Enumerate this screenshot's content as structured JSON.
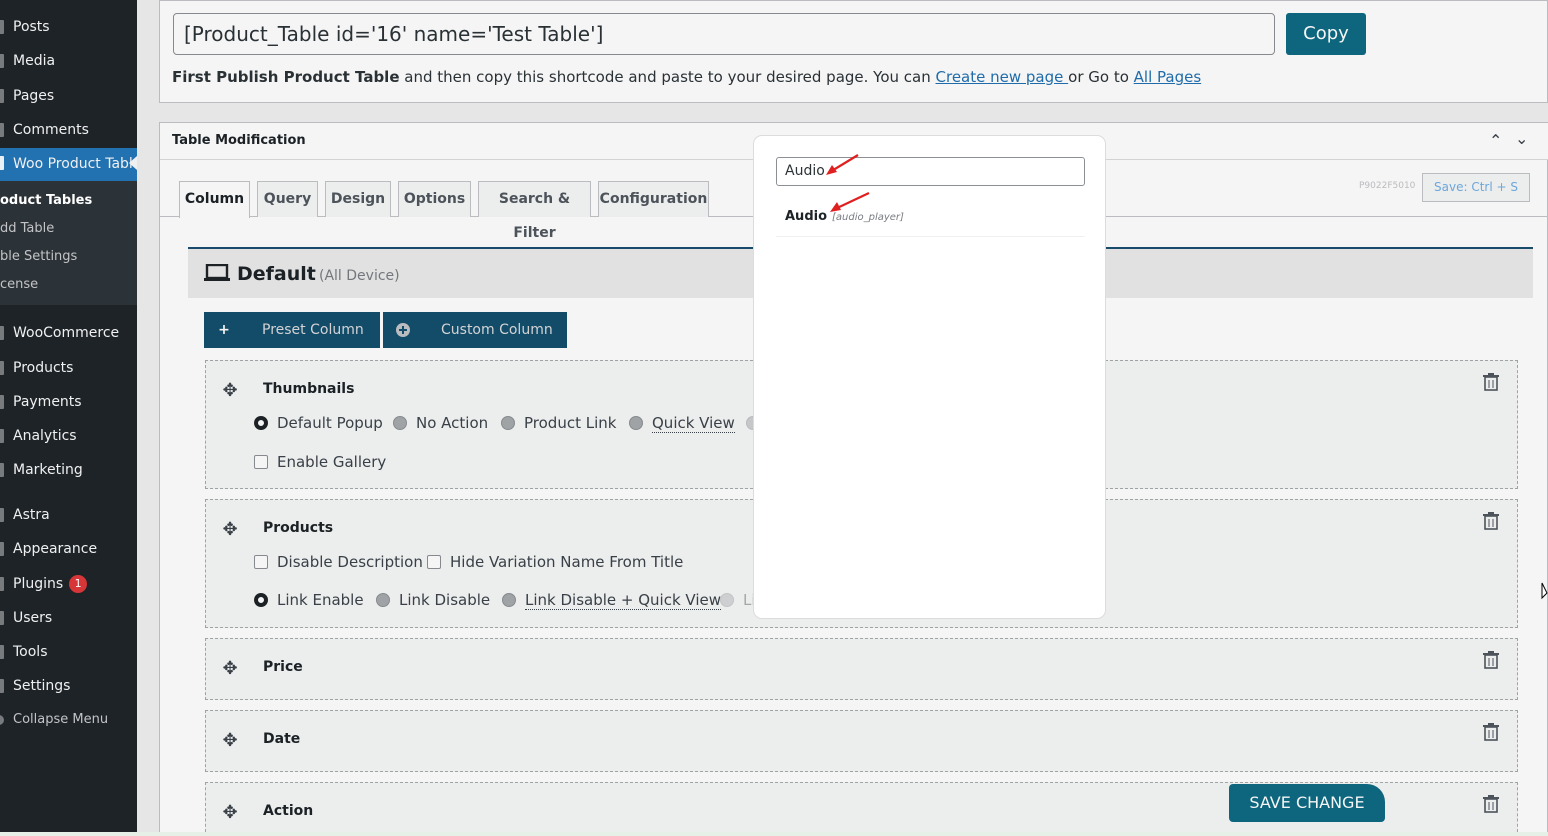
{
  "sidebar": {
    "items_top": [
      {
        "label": "Posts"
      },
      {
        "label": "Media"
      },
      {
        "label": "Pages"
      },
      {
        "label": "Comments"
      },
      {
        "label": "Woo Product Table"
      }
    ],
    "submenu": [
      {
        "label": "oduct Tables"
      },
      {
        "label": "dd Table"
      },
      {
        "label": "ble Settings"
      },
      {
        "label": "cense"
      }
    ],
    "items_bottom": [
      {
        "label": "WooCommerce"
      },
      {
        "label": "Products"
      },
      {
        "label": "Payments"
      },
      {
        "label": "Analytics"
      },
      {
        "label": "Marketing"
      },
      {
        "label": "Astra"
      },
      {
        "label": "Appearance"
      },
      {
        "label": "Plugins",
        "badge": "1"
      },
      {
        "label": "Users"
      },
      {
        "label": "Tools"
      },
      {
        "label": "Settings"
      }
    ],
    "collapse_label": "Collapse Menu"
  },
  "shortcode": {
    "value": "[Product_Table id='16' name='Test Table']",
    "copy_label": "Copy",
    "note_bold": "First Publish Product Table",
    "note_text": " and then copy this shortcode and paste to your desired page. You can ",
    "link_create": "Create new page ",
    "note_mid": "or Go to ",
    "link_all": "All Pages"
  },
  "table_mod": {
    "title": "Table Modification",
    "hash": "P9022F5010",
    "save_shortcut": "Save: Ctrl + S",
    "tabs": [
      "Column",
      "Query",
      "Design",
      "Options",
      "Search & Filter",
      "Configuration"
    ]
  },
  "device": {
    "title": "Default",
    "subtitle": "(All Device)"
  },
  "buttons": {
    "preset": "Preset Column",
    "custom": "Custom Column",
    "save_change": "SAVE CHANGE"
  },
  "columns": {
    "thumbnails": {
      "title": "Thumbnails",
      "options": [
        "Default Popup",
        "No Action",
        "Product Link",
        "Quick View"
      ],
      "gallery": "Enable Gallery"
    },
    "products": {
      "title": "Products",
      "checks": [
        "Disable Description",
        "Hide Variation Name From Title"
      ],
      "options": [
        "Link Enable",
        "Link Disable",
        "Link Disable + Quick View",
        "Li"
      ]
    },
    "price": {
      "title": "Price"
    },
    "date": {
      "title": "Date"
    },
    "action": {
      "title": "Action"
    }
  },
  "modal": {
    "search_value": "Audio",
    "result_label": "Audio",
    "result_code": "[audio_player]"
  },
  "colors": {
    "sidebar_bg": "#1d2327",
    "active_menu": "#2271b1",
    "primary_button": "#0e6b84",
    "dark_button": "#14506e",
    "arrow": "#e02020"
  }
}
